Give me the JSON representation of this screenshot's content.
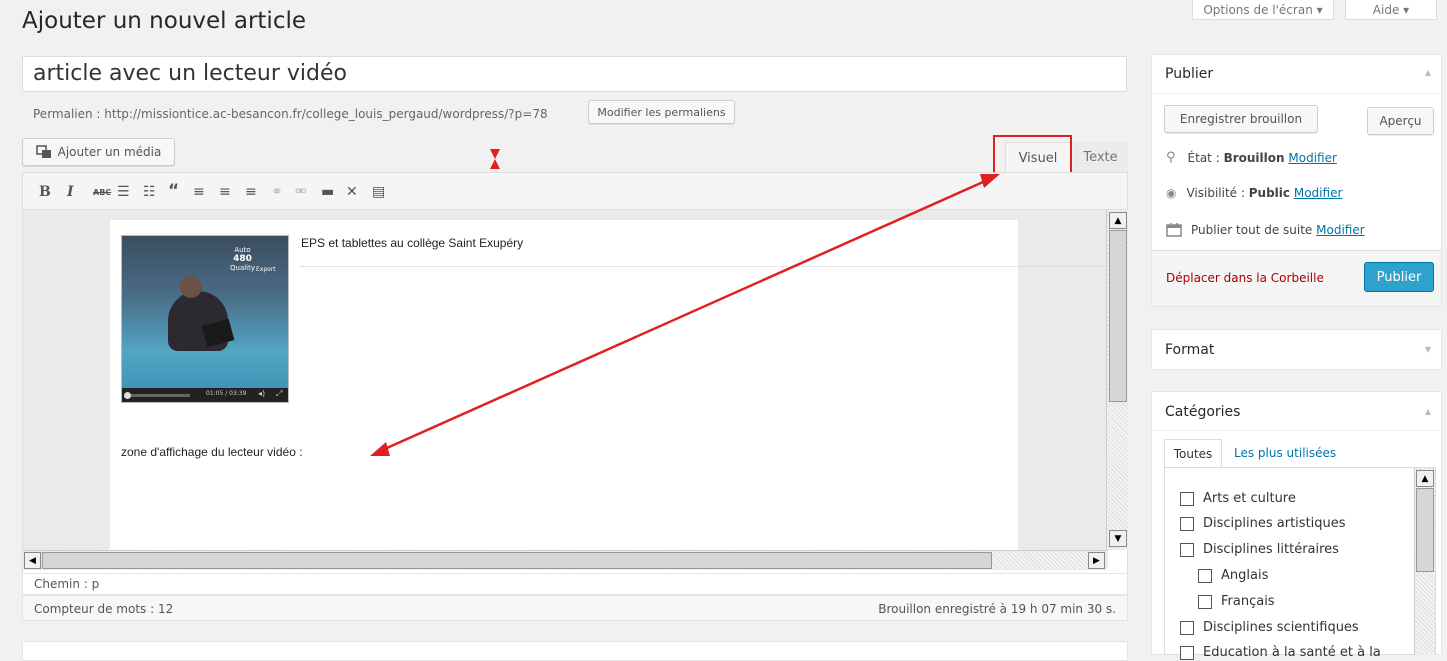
{
  "page_title": "Ajouter un nouvel article",
  "top_buttons": {
    "screen_options": "Options de l'écran ▾",
    "help": "Aide ▾"
  },
  "post_title": "article avec un lecteur vidéo",
  "permalink": {
    "label": "Permalien : http://missiontice.ac-besancon.fr/college_louis_pergaud/wordpress/?p=78",
    "button": "Modifier les permaliens"
  },
  "add_media": "Ajouter un média",
  "tabs": {
    "visual": "Visuel",
    "text": "Texte"
  },
  "content": {
    "video_caption": "EPS  et tablettes au collège Saint Exupéry",
    "video_time": "01:05 / 03:39",
    "video_overlay_1": "Auto",
    "video_overlay_2": "480",
    "video_overlay_3": "Quality",
    "video_overlay_4": "Export",
    "player_zone": "zone d'affichage du lecteur vidéo :"
  },
  "path_bar": "Chemin : p",
  "word_count": "Compteur de mots : 12",
  "draft_saved": "Brouillon enregistré à 19 h 07 min 30 s.",
  "publish_box": {
    "title": "Publier",
    "save_draft": "Enregistrer brouillon",
    "preview": "Aperçu",
    "status_label": "État :",
    "status_value": "Brouillon",
    "visibility_label": "Visibilité :",
    "visibility_value": "Public",
    "schedule_label": "Publier tout de suite",
    "modify": "Modifier",
    "trash": "Déplacer dans la Corbeille",
    "publish": "Publier"
  },
  "format_box": {
    "title": "Format"
  },
  "categories_box": {
    "title": "Catégories",
    "tab_all": "Toutes",
    "tab_popular": "Les plus utilisées",
    "items": [
      "Arts et culture",
      "Disciplines artistiques",
      "Disciplines littéraires",
      "Anglais",
      "Français",
      "Disciplines scientifiques",
      "Education à la santé et à la"
    ]
  },
  "colors": {
    "accent": "#0073aa",
    "publish_button": "#2ea2cc",
    "trash": "#a00",
    "annotation": "#e02020"
  }
}
